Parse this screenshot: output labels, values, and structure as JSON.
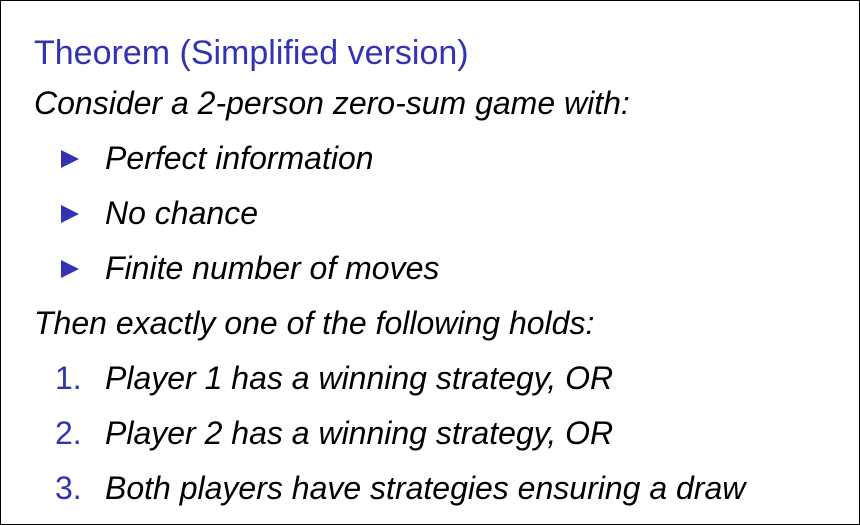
{
  "theorem": {
    "title": "Theorem (Simplified version)",
    "intro": "Consider a 2-person zero-sum game with:",
    "conditions": [
      "Perfect information",
      "No chance",
      "Finite number of moves"
    ],
    "conclusion": "Then exactly one of the following holds:",
    "outcomes": [
      {
        "number": "1.",
        "text": "Player 1 has a winning strategy, OR"
      },
      {
        "number": "2.",
        "text": "Player 2 has a winning strategy, OR"
      },
      {
        "number": "3.",
        "text": "Both players have strategies ensuring a draw"
      }
    ]
  },
  "colors": {
    "accent": "#3333b2",
    "text": "#000000",
    "background": "#ffffff",
    "border": "#000000"
  },
  "icons": {
    "bullet": "triangle-right-icon"
  }
}
